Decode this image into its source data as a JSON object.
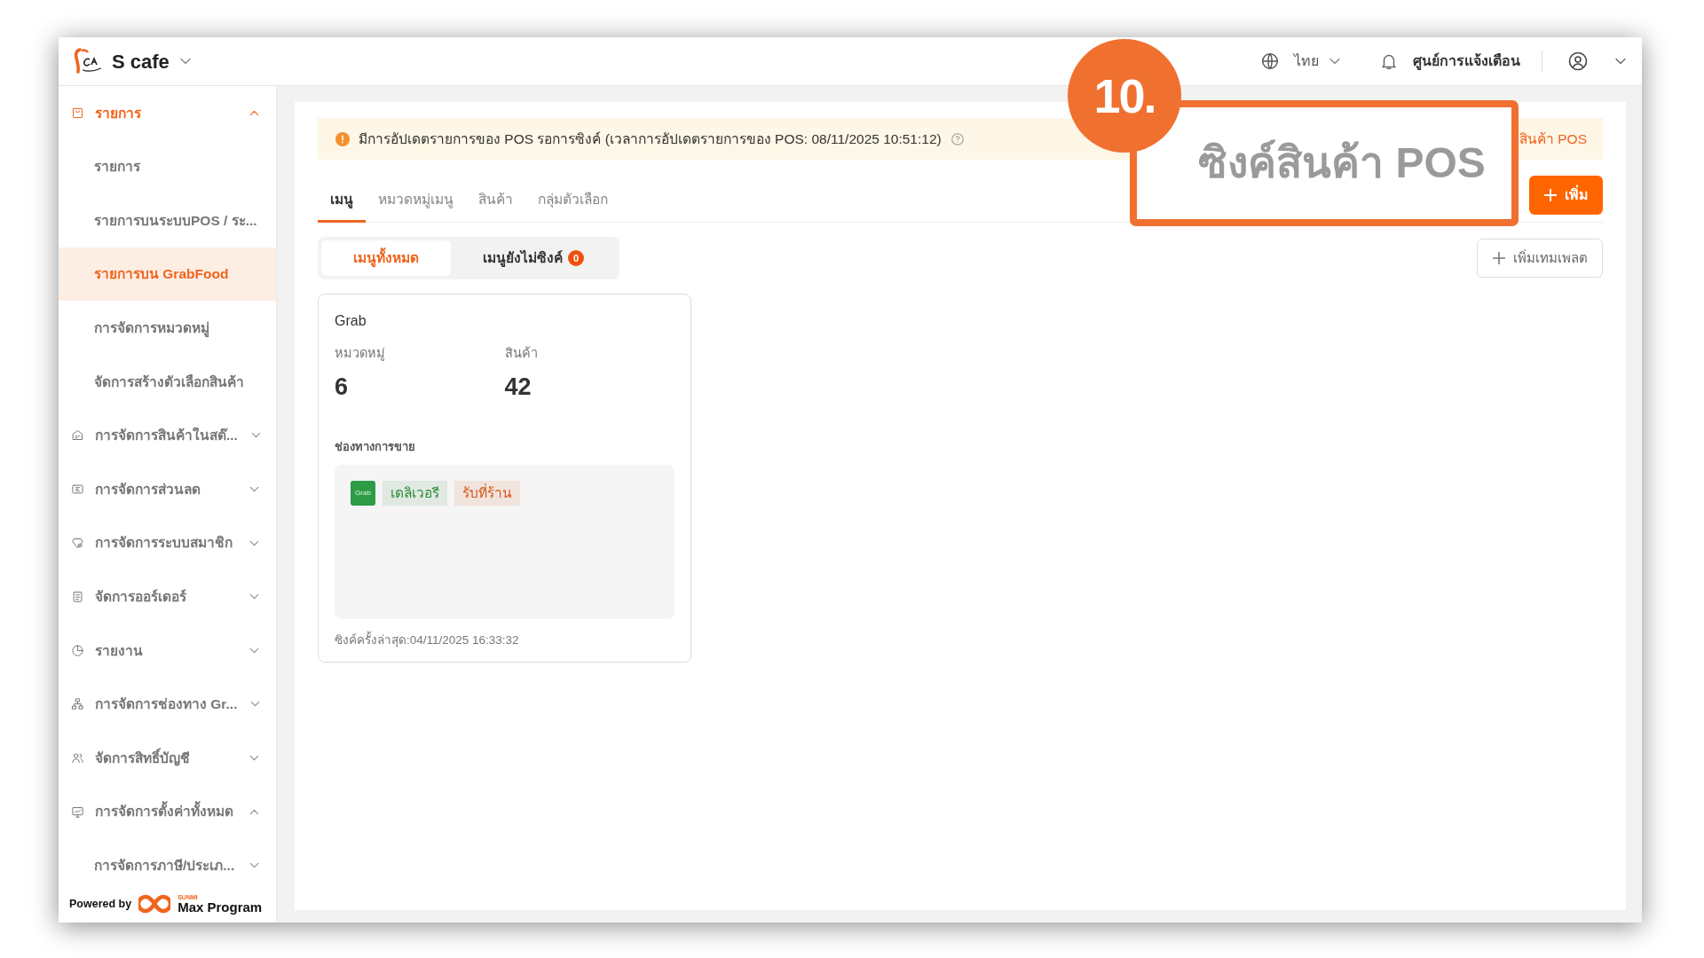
{
  "brand": {
    "name": "S cafe"
  },
  "topbar": {
    "language": "ไทย",
    "notifications": "ศูนย์การแจ้งเตือน"
  },
  "sidebar": {
    "items": [
      {
        "label": "รายการ",
        "expanded": true,
        "selected": true,
        "children": [
          {
            "label": "รายการ",
            "kind": "link",
            "selected": false
          },
          {
            "label": "รายการบนระบบPOS / ระ...",
            "kind": "link",
            "selected": false
          },
          {
            "label": "รายการบน GrabFood",
            "kind": "link",
            "selected": true
          },
          {
            "label": "การจัดการหมวดหมู่",
            "kind": "link",
            "selected": false
          },
          {
            "label": "จัดการสร้างตัวเลือกสินค้า",
            "kind": "link",
            "selected": false
          }
        ]
      },
      {
        "label": "การจัดการสินค้าในสต๊...",
        "expanded": false,
        "selected": false
      },
      {
        "label": "การจัดการส่วนลด",
        "expanded": false,
        "selected": false
      },
      {
        "label": "การจัดการระบบสมาชิก",
        "expanded": false,
        "selected": false
      },
      {
        "label": "จัดการออร์เดอร์",
        "expanded": false,
        "selected": false
      },
      {
        "label": "รายงาน",
        "expanded": false,
        "selected": false
      },
      {
        "label": "การจัดการช่องทาง Gr...",
        "expanded": false,
        "selected": false
      },
      {
        "label": "จัดการสิทธิ์บัญชี",
        "expanded": false,
        "selected": false
      },
      {
        "label": "การจัดการตั้งค่าทั้งหมด",
        "expanded": true,
        "selected": false,
        "children": [
          {
            "label": "การจัดการภาษี/ประเภ...",
            "kind": "group",
            "selected": false,
            "expanded": false
          }
        ]
      }
    ],
    "footer": {
      "powered_by": "Powered by",
      "logo_small": "SUNMI",
      "logo_text": "Max Program"
    }
  },
  "banner": {
    "message": "มีการอัปเดตรายการของ POS รอการซิงค์ (เวลาการอัปเดตรายการของ POS: 08/11/2025 10:51:12)",
    "action": "สินค้า POS"
  },
  "tabs": [
    {
      "label": "เมนู",
      "selected": true
    },
    {
      "label": "หมวดหมู่เมนู",
      "selected": false
    },
    {
      "label": "สินค้า",
      "selected": false
    },
    {
      "label": "กลุ่มตัวเลือก",
      "selected": false
    }
  ],
  "add_button": "เพิ่ม",
  "segments": [
    {
      "label": "เมนูทั้งหมด",
      "selected": true
    },
    {
      "label": "เมนูยังไม่ซิงค์",
      "selected": false,
      "count": "0"
    }
  ],
  "template_button": "เพิ่มเทมเพลต",
  "cards": [
    {
      "title": "Grab",
      "stats": [
        {
          "label": "หมวดหมู่",
          "value": "6"
        },
        {
          "label": "สินค้า",
          "value": "42"
        }
      ],
      "channels_label": "ช่องทางการขาย",
      "logo": "Grab",
      "tags": [
        {
          "label": "เดลิเวอรี",
          "color": "#2e8b3e"
        },
        {
          "label": "รับที่ร้าน",
          "color": "#d4581c"
        }
      ],
      "last_sync": "ซิงค์ครั้งล่าสุด:04/11/2025 16:33:32"
    }
  ],
  "callout": {
    "number": "10.",
    "text": "ซิงค์สินค้า POS"
  }
}
